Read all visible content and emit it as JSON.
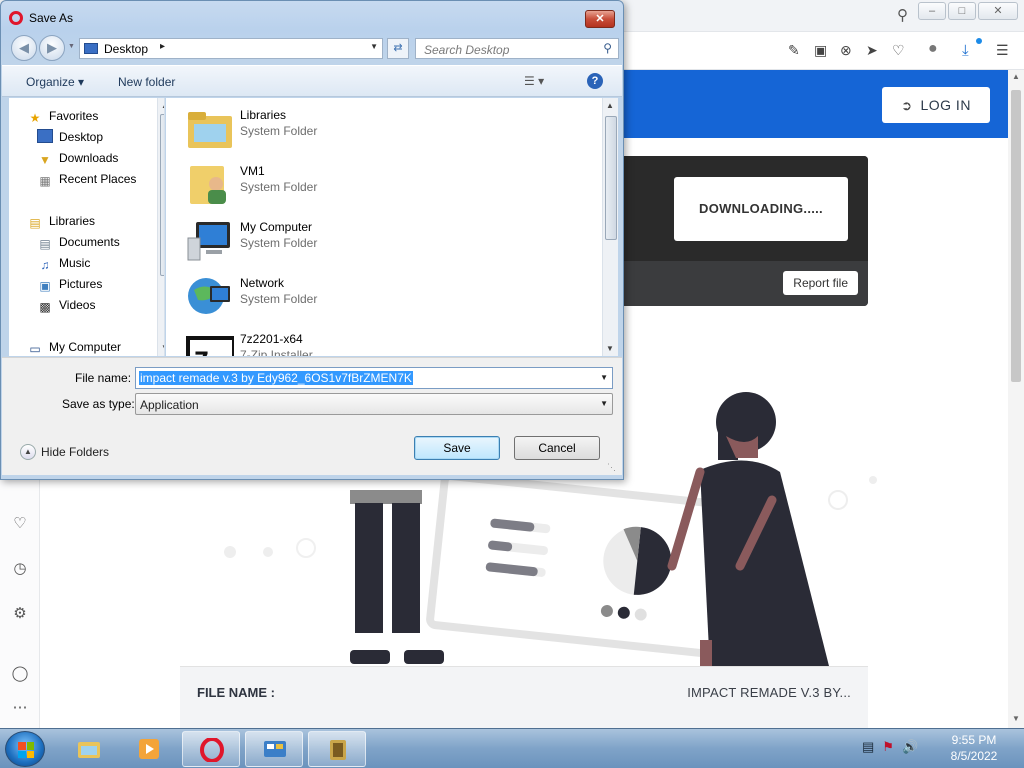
{
  "browser": {
    "toolbar_icons": [
      "edit-icon",
      "camera-icon",
      "close-circle-icon",
      "send-icon",
      "heart-icon",
      "account-icon",
      "download-icon",
      "settings-icon"
    ],
    "sidebar_icons": [
      "heart-icon",
      "clock-icon",
      "gear-icon",
      "lightbulb-icon",
      "more-icon"
    ]
  },
  "page": {
    "login_label": "LOG IN",
    "downloading_label": "DOWNLOADING.....",
    "report_label": "Report file",
    "file_name_label": "FILE NAME :",
    "file_name_value": "IMPACT REMADE V.3 BY...",
    "header_color": "#1565d6"
  },
  "dialog": {
    "title": "Save As",
    "close_label": "✕",
    "address": "Desktop",
    "search_placeholder": "Search Desktop",
    "organize_label": "Organize ▾",
    "new_folder_label": "New folder",
    "help_label": "?",
    "nav_items": [
      {
        "label": "Favorites",
        "icon": "star-icon"
      },
      {
        "label": "Desktop",
        "icon": "desktop-icon"
      },
      {
        "label": "Downloads",
        "icon": "downloads-folder-icon"
      },
      {
        "label": "Recent Places",
        "icon": "recent-places-icon"
      },
      {
        "label": "Libraries",
        "icon": "libraries-icon"
      },
      {
        "label": "Documents",
        "icon": "documents-icon"
      },
      {
        "label": "Music",
        "icon": "music-icon"
      },
      {
        "label": "Pictures",
        "icon": "pictures-icon"
      },
      {
        "label": "Videos",
        "icon": "videos-icon"
      },
      {
        "label": "My Computer",
        "icon": "computer-icon"
      }
    ],
    "files": [
      {
        "name": "Libraries",
        "type": "System Folder",
        "icon": "libraries-folder-icon"
      },
      {
        "name": "VM1",
        "type": "System Folder",
        "icon": "user-folder-icon"
      },
      {
        "name": "My Computer",
        "type": "System Folder",
        "icon": "computer-icon"
      },
      {
        "name": "Network",
        "type": "System Folder",
        "icon": "network-icon"
      },
      {
        "name": "7z2201-x64",
        "type": "7-Zip Installer",
        "icon": "7zip-icon"
      }
    ],
    "file_name_label": "File name:",
    "file_name_value": "impact remade v.3 by Edy962_6OS1v7fBrZMEN7K",
    "save_type_label": "Save as type:",
    "save_type_value": "Application",
    "hide_folders_label": "Hide Folders",
    "save_label": "Save",
    "cancel_label": "Cancel"
  },
  "taskbar": {
    "apps": [
      "explorer-icon",
      "media-player-icon",
      "opera-icon",
      "control-panel-icon",
      "installer-icon"
    ],
    "time": "9:55 PM",
    "date": "8/5/2022"
  }
}
